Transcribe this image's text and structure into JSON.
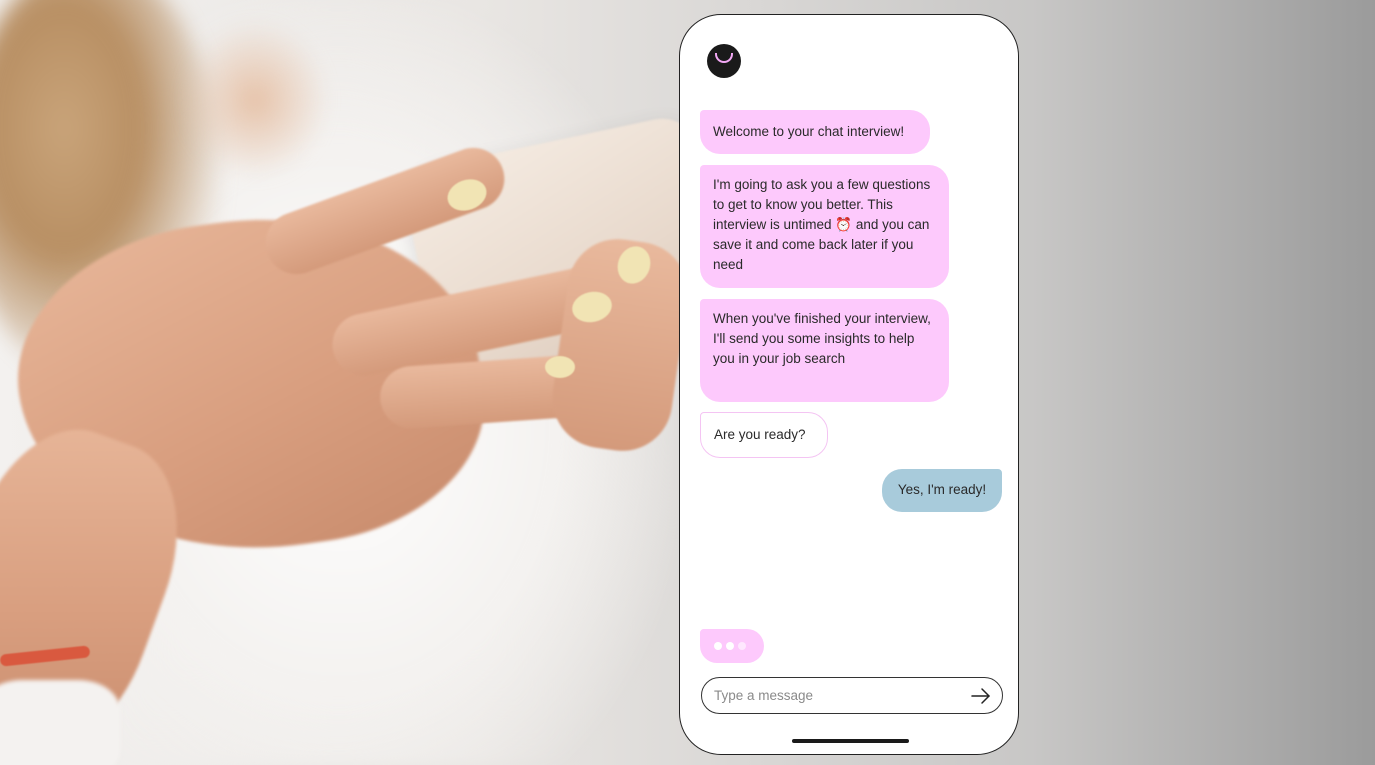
{
  "chat": {
    "messages": [
      {
        "sender": "bot",
        "text": "Welcome to your chat interview!"
      },
      {
        "sender": "bot",
        "text": "I'm going to ask you a few questions to get to know you better. This interview is untimed ⏰ and you can save it and come back later if you need"
      },
      {
        "sender": "bot",
        "text": "When you've finished your interview, I'll send you some insights to help you in your job search"
      },
      {
        "sender": "bot",
        "text": "Are you ready?"
      },
      {
        "sender": "user",
        "text": "Yes, I'm ready!"
      }
    ],
    "typing_indicator": true
  },
  "composer": {
    "placeholder": "Type a message",
    "value": ""
  },
  "icons": {
    "logo": "smile-logo-icon",
    "send": "arrow-right-icon",
    "typing": "typing-dots-icon"
  },
  "colors": {
    "bot_bubble": "#fdc9fc",
    "user_bubble": "#a8cbdb",
    "logo_bg": "#1a1a1a",
    "logo_smile": "#f3a9f5"
  }
}
